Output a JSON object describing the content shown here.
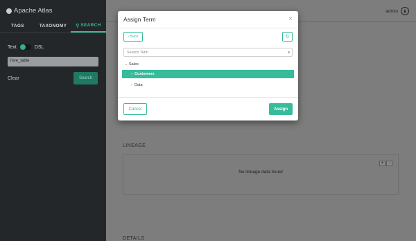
{
  "app": {
    "brand": "Apache Atlas",
    "brand_icon": "globe-icon"
  },
  "sidebar": {
    "tabs": [
      {
        "label": "TAGS",
        "active": false
      },
      {
        "label": "TAXONOMY",
        "active": false
      },
      {
        "label": "SEARCH",
        "active": true,
        "icon": "search-icon"
      }
    ],
    "toggle": {
      "left_label": "Text",
      "right_label": "DSL",
      "state": "Text"
    },
    "search_value": "hive_table",
    "clear_label": "Clear",
    "search_button": "Search"
  },
  "header": {
    "user": "admin",
    "user_icon": "user-icon"
  },
  "main": {
    "lineage_title": "LINEAGE",
    "lineage_empty": "No lineage data found",
    "zoom_in": "+",
    "zoom_out": "-",
    "details_title": "DETAILS"
  },
  "modal": {
    "title": "Assign Term",
    "close": "×",
    "back_label": "Back",
    "refresh_icon": "refresh-icon",
    "search_placeholder": "Search Term",
    "tree": [
      {
        "label": "Sales",
        "expanded": true,
        "level": 0
      },
      {
        "label": "Customers",
        "level": 1,
        "selected": true
      },
      {
        "label": "Data",
        "level": 1
      }
    ],
    "cancel_label": "Cancel",
    "assign_label": "Assign"
  },
  "colors": {
    "accent": "#37bb9b",
    "sidebar_bg": "#23272a",
    "overlay": "#7d7d7d"
  }
}
